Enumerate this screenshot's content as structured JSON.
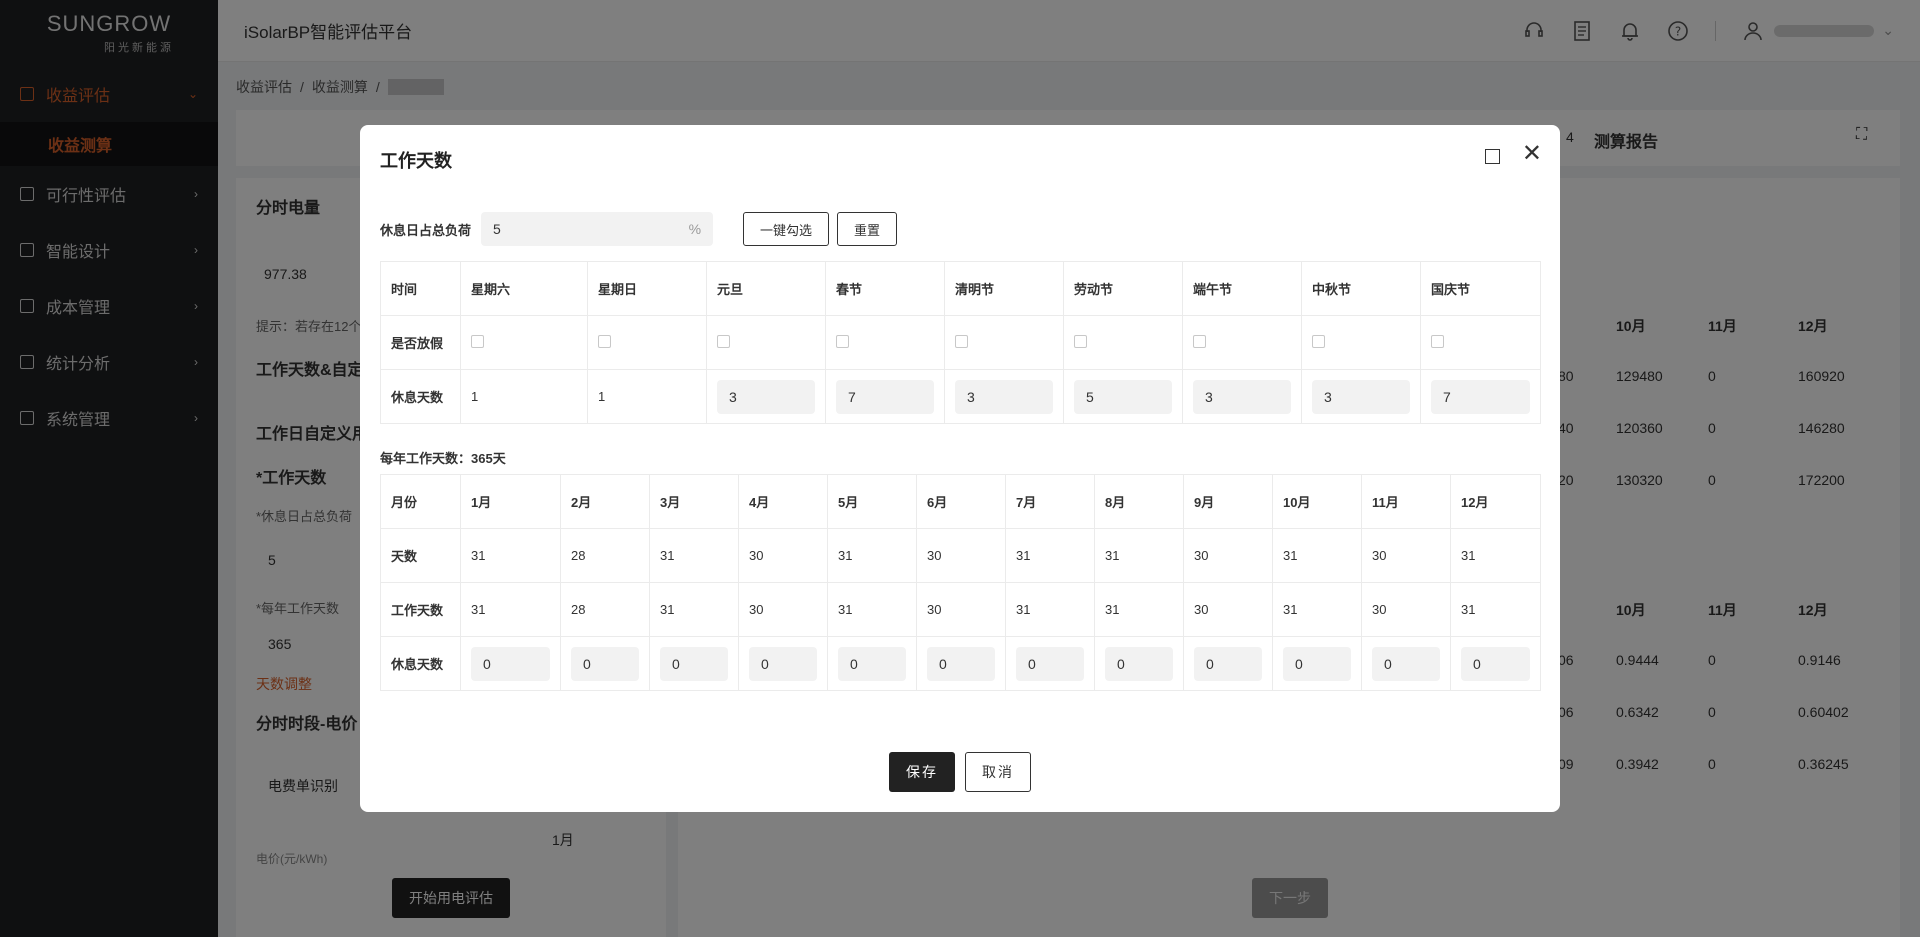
{
  "sidebar": {
    "logo_brand": "SUNGROW",
    "logo_sub": "阳光新能源",
    "items": [
      {
        "label": "收益评估",
        "active": true
      },
      {
        "label": "可行性评估"
      },
      {
        "label": "智能设计"
      },
      {
        "label": "成本管理"
      },
      {
        "label": "统计分析"
      },
      {
        "label": "系统管理"
      }
    ],
    "sub_item": "收益测算"
  },
  "header": {
    "title": "iSolarBP智能评估平台"
  },
  "breadcrumb": {
    "items": [
      "收益评估",
      "/",
      "收益测算",
      "/"
    ]
  },
  "background": {
    "step4_num": "4",
    "step4_label": "测算报告",
    "panel_title": "分时电量",
    "value_977": "977.38",
    "hint": "提示：若存在12个",
    "section_work": "工作天数&自定",
    "section_custom": "工作日自定义用",
    "work_days_label": "*工作天数",
    "rest_ratio_label": "*休息日占总负荷",
    "rest_ratio_value": "5",
    "year_work_label": "*每年工作天数",
    "year_work_value": "365",
    "days_adjust": "天数调整",
    "price_section": "分时时段-电价",
    "bill_id": "电费单识别",
    "month_select": "1月",
    "price_unit": "电价(元/kWh)",
    "start_btn": "开始用电评估",
    "next_btn": "下一步",
    "tbl1_headers": [
      "10月",
      "11月",
      "12月"
    ],
    "tbl1_rows": [
      [
        "80",
        "129480",
        "0",
        "160920"
      ],
      [
        "40",
        "120360",
        "0",
        "146280"
      ],
      [
        "20",
        "130320",
        "0",
        "172200"
      ]
    ],
    "tbl2_headers": [
      "10月",
      "11月",
      "12月"
    ],
    "tbl2_rows": [
      [
        "06",
        "0.9444",
        "0",
        "0.9146"
      ],
      [
        "06",
        "0.6342",
        "0",
        "0.60402"
      ],
      [
        "09",
        "0.3942",
        "0",
        "0.36245"
      ]
    ]
  },
  "modal": {
    "title": "工作天数",
    "load_label": "休息日占总负荷",
    "load_value": "5",
    "load_unit": "%",
    "select_all_btn": "一键勾选",
    "reset_btn": "重置",
    "holiday_table": {
      "col_header": "时间",
      "columns": [
        "星期六",
        "星期日",
        "元旦",
        "春节",
        "清明节",
        "劳动节",
        "端午节",
        "中秋节",
        "国庆节"
      ],
      "row_holiday_label": "是否放假",
      "row_rest_label": "休息天数",
      "rest_days": [
        "1",
        "1",
        "3",
        "7",
        "3",
        "5",
        "3",
        "3",
        "7"
      ]
    },
    "yearly_label": "每年工作天数：365天",
    "month_table": {
      "col_header": "月份",
      "months": [
        "1月",
        "2月",
        "3月",
        "4月",
        "5月",
        "6月",
        "7月",
        "8月",
        "9月",
        "10月",
        "11月",
        "12月"
      ],
      "row_days_label": "天数",
      "days": [
        "31",
        "28",
        "31",
        "30",
        "31",
        "30",
        "31",
        "31",
        "30",
        "31",
        "30",
        "31"
      ],
      "row_work_label": "工作天数",
      "work_days": [
        "31",
        "28",
        "31",
        "30",
        "31",
        "30",
        "31",
        "31",
        "30",
        "31",
        "30",
        "31"
      ],
      "row_rest_label": "休息天数",
      "rest_days": [
        "0",
        "0",
        "0",
        "0",
        "0",
        "0",
        "0",
        "0",
        "0",
        "0",
        "0",
        "0"
      ]
    },
    "save_btn": "保存",
    "cancel_btn": "取消"
  }
}
